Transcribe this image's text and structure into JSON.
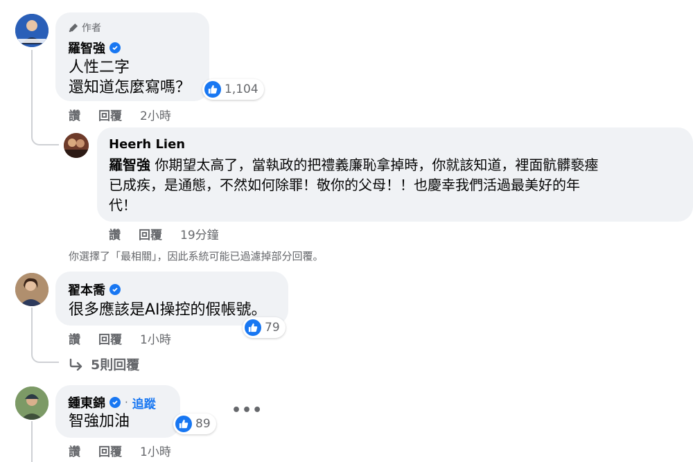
{
  "comments": [
    {
      "author_badge": "作者",
      "name": "羅智強",
      "lines": [
        "人性二字",
        "還知道怎麼寫嗎？"
      ],
      "reactions": "1,104",
      "actions": {
        "like": "讚",
        "reply": "回覆",
        "time": "2小時"
      },
      "reply": {
        "name": "Heerh Lien",
        "mention": "羅智強",
        "text_line1": " 你期望太高了，當執政的把禮義廉恥拿掉時，你就該知道，裡面骯髒褻瘞",
        "text_line2": "已成疾，是通態，不然如何除罪！敬你的父母！！也慶幸我們活過最美好的年",
        "text_line3": "代！",
        "actions": {
          "like": "讚",
          "reply": "回覆",
          "time": "19分鐘"
        }
      }
    },
    {
      "name": "翟本喬",
      "lines": [
        "很多應該是AI操控的假帳號。"
      ],
      "reactions": "79",
      "actions": {
        "like": "讚",
        "reply": "回覆",
        "time": "1小時"
      },
      "view_replies": "5則回覆"
    },
    {
      "name": "鍾東錦",
      "follow": "追蹤",
      "separator": "·",
      "lines": [
        "智強加油"
      ],
      "reactions": "89",
      "actions": {
        "like": "讚",
        "reply": "回覆",
        "time": "1小時"
      },
      "more": "•••"
    }
  ],
  "filter_notice": "你選擇了「最相關」，因此系統可能已過濾掉部分回覆。",
  "colors": {
    "accent": "#1877f2",
    "bubble": "#f0f2f5",
    "muted": "#65676b"
  }
}
